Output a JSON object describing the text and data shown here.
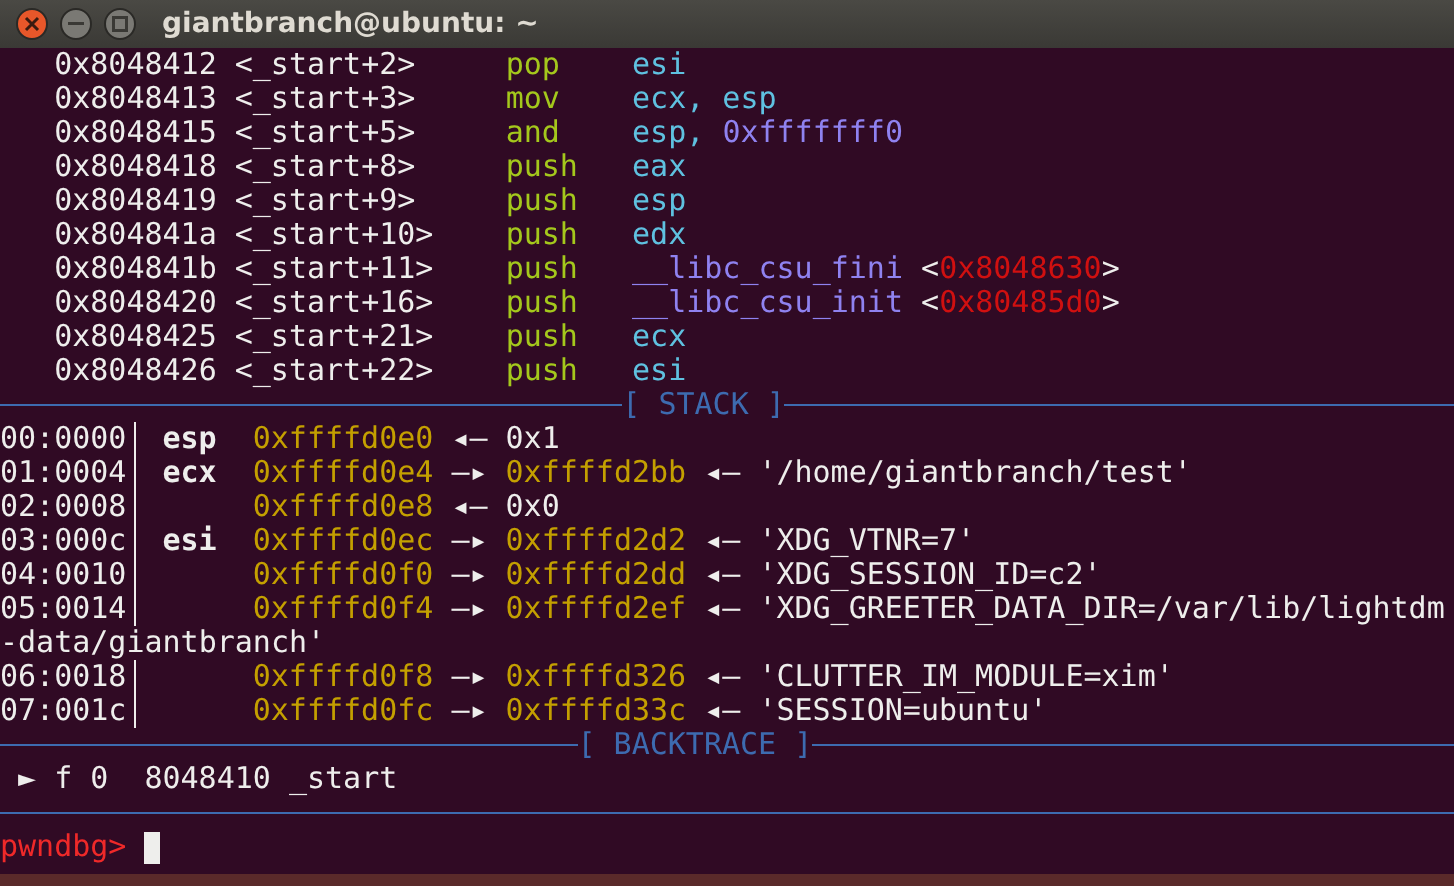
{
  "window": {
    "title": "giantbranch@ubuntu: ~"
  },
  "disassembly": [
    {
      "address": "0x8048412",
      "symbol": "<_start+2>",
      "mnemonic": "pop",
      "operands": [
        {
          "kind": "register",
          "text": "esi"
        }
      ]
    },
    {
      "address": "0x8048413",
      "symbol": "<_start+3>",
      "mnemonic": "mov",
      "operands": [
        {
          "kind": "register",
          "text": "ecx, esp"
        }
      ]
    },
    {
      "address": "0x8048415",
      "symbol": "<_start+5>",
      "mnemonic": "and",
      "operands": [
        {
          "kind": "register",
          "text": "esp, "
        },
        {
          "kind": "immediate",
          "text": "0xfffffff0"
        }
      ]
    },
    {
      "address": "0x8048418",
      "symbol": "<_start+8>",
      "mnemonic": "push",
      "operands": [
        {
          "kind": "register",
          "text": "eax"
        }
      ]
    },
    {
      "address": "0x8048419",
      "symbol": "<_start+9>",
      "mnemonic": "push",
      "operands": [
        {
          "kind": "register",
          "text": "esp"
        }
      ]
    },
    {
      "address": "0x804841a",
      "symbol": "<_start+10>",
      "mnemonic": "push",
      "operands": [
        {
          "kind": "register",
          "text": "edx"
        }
      ]
    },
    {
      "address": "0x804841b",
      "symbol": "<_start+11>",
      "mnemonic": "push",
      "operands": [
        {
          "kind": "function",
          "text": "__libc_csu_fini "
        },
        {
          "kind": "plain",
          "text": "<"
        },
        {
          "kind": "address",
          "text": "0x8048630"
        },
        {
          "kind": "plain",
          "text": ">"
        }
      ]
    },
    {
      "address": "0x8048420",
      "symbol": "<_start+16>",
      "mnemonic": "push",
      "operands": [
        {
          "kind": "function",
          "text": "__libc_csu_init "
        },
        {
          "kind": "plain",
          "text": "<"
        },
        {
          "kind": "address",
          "text": "0x80485d0"
        },
        {
          "kind": "plain",
          "text": ">"
        }
      ]
    },
    {
      "address": "0x8048425",
      "symbol": "<_start+21>",
      "mnemonic": "push",
      "operands": [
        {
          "kind": "register",
          "text": "ecx"
        }
      ]
    },
    {
      "address": "0x8048426",
      "symbol": "<_start+22>",
      "mnemonic": "push",
      "operands": [
        {
          "kind": "register",
          "text": "esi"
        }
      ]
    }
  ],
  "stack": {
    "title": "[ STACK ]",
    "rows": [
      {
        "kind": "entry",
        "index": "00:0000",
        "register": "esp",
        "chain": [
          {
            "kind": "pointer",
            "text": "0xffffd0e0"
          },
          {
            "kind": "arrow",
            "text": "◂—"
          },
          {
            "kind": "value",
            "text": "0x1"
          }
        ]
      },
      {
        "kind": "entry",
        "index": "01:0004",
        "register": "ecx",
        "chain": [
          {
            "kind": "pointer",
            "text": "0xffffd0e4"
          },
          {
            "kind": "arrow",
            "text": "—▸"
          },
          {
            "kind": "pointer",
            "text": "0xffffd2bb"
          },
          {
            "kind": "arrow",
            "text": "◂—"
          },
          {
            "kind": "value",
            "text": "'/home/giantbranch/test'"
          }
        ]
      },
      {
        "kind": "entry",
        "index": "02:0008",
        "chain": [
          {
            "kind": "pointer",
            "text": "0xffffd0e8"
          },
          {
            "kind": "arrow",
            "text": "◂—"
          },
          {
            "kind": "value",
            "text": "0x0"
          }
        ]
      },
      {
        "kind": "entry",
        "index": "03:000c",
        "register": "esi",
        "chain": [
          {
            "kind": "pointer",
            "text": "0xffffd0ec"
          },
          {
            "kind": "arrow",
            "text": "—▸"
          },
          {
            "kind": "pointer",
            "text": "0xffffd2d2"
          },
          {
            "kind": "arrow",
            "text": "◂—"
          },
          {
            "kind": "value",
            "text": "'XDG_VTNR=7'"
          }
        ]
      },
      {
        "kind": "entry",
        "index": "04:0010",
        "chain": [
          {
            "kind": "pointer",
            "text": "0xffffd0f0"
          },
          {
            "kind": "arrow",
            "text": "—▸"
          },
          {
            "kind": "pointer",
            "text": "0xffffd2dd"
          },
          {
            "kind": "arrow",
            "text": "◂—"
          },
          {
            "kind": "value",
            "text": "'XDG_SESSION_ID=c2'"
          }
        ]
      },
      {
        "kind": "entry",
        "index": "05:0014",
        "chain": [
          {
            "kind": "pointer",
            "text": "0xffffd0f4"
          },
          {
            "kind": "arrow",
            "text": "—▸"
          },
          {
            "kind": "pointer",
            "text": "0xffffd2ef"
          },
          {
            "kind": "arrow",
            "text": "◂—"
          },
          {
            "kind": "value",
            "text": "'XDG_GREETER_DATA_DIR=/var/lib/lightdm"
          }
        ]
      },
      {
        "kind": "continuation",
        "text": "-data/giantbranch'"
      },
      {
        "kind": "entry",
        "index": "06:0018",
        "chain": [
          {
            "kind": "pointer",
            "text": "0xffffd0f8"
          },
          {
            "kind": "arrow",
            "text": "—▸"
          },
          {
            "kind": "pointer",
            "text": "0xffffd326"
          },
          {
            "kind": "arrow",
            "text": "◂—"
          },
          {
            "kind": "value",
            "text": "'CLUTTER_IM_MODULE=xim'"
          }
        ]
      },
      {
        "kind": "entry",
        "index": "07:001c",
        "chain": [
          {
            "kind": "pointer",
            "text": "0xffffd0fc"
          },
          {
            "kind": "arrow",
            "text": "—▸"
          },
          {
            "kind": "pointer",
            "text": "0xffffd33c"
          },
          {
            "kind": "arrow",
            "text": "◂—"
          },
          {
            "kind": "value",
            "text": "'SESSION=ubuntu'"
          }
        ]
      }
    ]
  },
  "backtrace": {
    "title": "[ BACKTRACE ]",
    "frames": [
      {
        "marker": "►",
        "text": "f 0  8048410 _start"
      }
    ]
  },
  "prompt": {
    "text": "pwndbg>"
  }
}
